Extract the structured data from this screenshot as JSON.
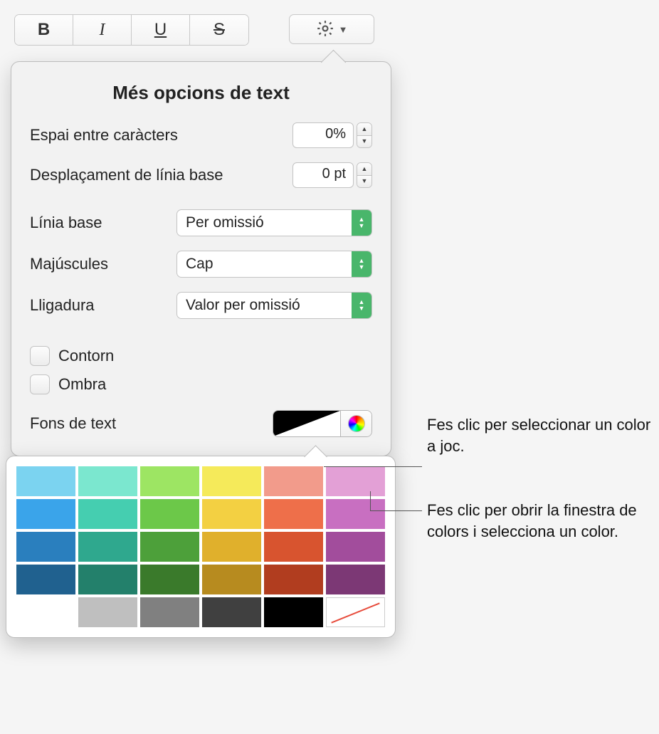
{
  "toolbar": {
    "bold": "B",
    "italic": "I",
    "underline": "U",
    "strike": "S"
  },
  "popover": {
    "title": "Més opcions de text",
    "char_spacing_label": "Espai entre caràcters",
    "char_spacing_value": "0%",
    "baseline_shift_label": "Desplaçament de línia base",
    "baseline_shift_value": "0 pt",
    "baseline_label": "Línia base",
    "baseline_value": "Per omissió",
    "caps_label": "Majúscules",
    "caps_value": "Cap",
    "ligature_label": "Lligadura",
    "ligature_value": "Valor per omissió",
    "outline_label": "Contorn",
    "shadow_label": "Ombra",
    "textbg_label": "Fons de text"
  },
  "swatches": {
    "rows": [
      [
        "#7bd3f0",
        "#7be7cf",
        "#9de563",
        "#f5ea5a",
        "#f29b8b",
        "#e3a0d6"
      ],
      [
        "#3aa4ea",
        "#45ceb0",
        "#6cc849",
        "#f3d042",
        "#ee6f4a",
        "#c86fc1"
      ],
      [
        "#2a7fbe",
        "#2fa88e",
        "#4da03a",
        "#e0b02c",
        "#d8542f",
        "#a24d9c"
      ],
      [
        "#20618f",
        "#23806b",
        "#3a7a2b",
        "#b78b1f",
        "#b13d1f",
        "#7c3875"
      ],
      [
        "#ffffff",
        "#bfbfbf",
        "#808080",
        "#404040",
        "#000000",
        "none"
      ]
    ]
  },
  "callouts": {
    "c1": "Fes clic per seleccionar un color a joc.",
    "c2": "Fes clic per obrir la finestra de colors i selecciona un color."
  }
}
